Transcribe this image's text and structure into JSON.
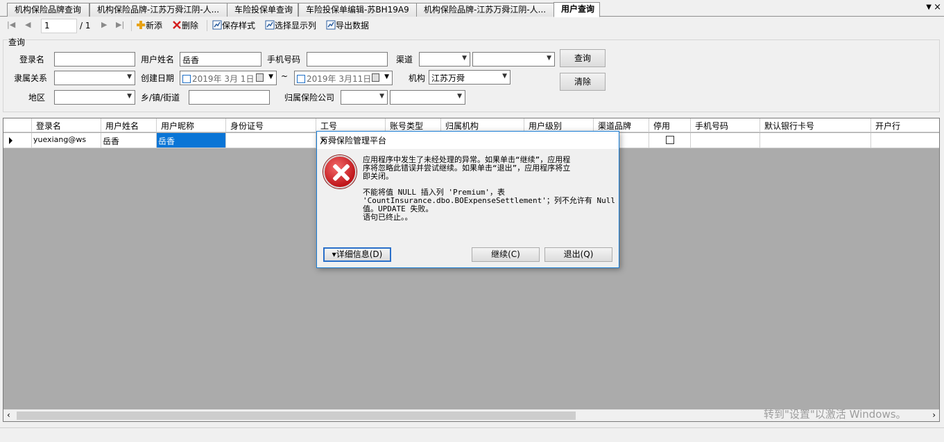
{
  "tabs": [
    {
      "label": "机构保险品牌查询"
    },
    {
      "label": "机构保险品牌-江苏万舜江阴-人..."
    },
    {
      "label": "车险投保单查询"
    },
    {
      "label": "车险投保单编辑-苏BH19A9"
    },
    {
      "label": "机构保险品牌-江苏万舜江阴-人..."
    },
    {
      "label": "用户查询"
    }
  ],
  "tab_menu_glyph": "▼",
  "tab_close_glyph": "×",
  "toolbar": {
    "page_current": "1",
    "page_total": "/ 1",
    "add_label": "新添",
    "delete_label": "删除",
    "save_style_label": "保存样式",
    "choose_columns_label": "选择显示列",
    "export_label": "导出数据"
  },
  "query": {
    "group_title": "查询",
    "login_label": "登录名",
    "login_value": "",
    "username_label": "用户姓名",
    "username_value": "岳香",
    "phone_label": "手机号码",
    "phone_value": "",
    "channel_label": "渠道",
    "affiliation_label": "隶属关系",
    "created_label": "创建日期",
    "date_from": "2019年  3月 1日",
    "date_sep": "~",
    "date_to": "2019年  3月11日",
    "org_label": "机构",
    "org_value": "江苏万舜",
    "region_label": "地区",
    "town_label": "乡/镇/街道",
    "town_value": "",
    "insurer_label": "归属保险公司",
    "search_button": "查询",
    "clear_button": "清除"
  },
  "grid": {
    "columns": [
      "登录名",
      "用户姓名",
      "用户昵称",
      "身份证号",
      "工号",
      "账号类型",
      "归属机构",
      "用户级别",
      "渠道品牌",
      "停用",
      "手机号码",
      "默认银行卡号",
      "开户行"
    ],
    "rows": [
      {
        "login": "yuexiang@ws",
        "name": "岳香",
        "nickname": "岳香",
        "disabled": false
      }
    ]
  },
  "dialog": {
    "title": "万舜保险管理平台",
    "close_glyph": "✕",
    "message_1": "应用程序中发生了未经处理的异常。如果单击“继续”，应用程\n序将忽略此错误并尝试继续。如果单击“退出”，应用程序将立\n即关闭。",
    "message_2": "不能将值 NULL 插入列 'Premium'，表\n'CountInsurance.dbo.BOExpenseSettlement'；列不允许有 Null\n值。UPDATE 失败。\n语句已终止。。",
    "details_button": "▾详细信息(D)",
    "continue_button": "继续(C)",
    "quit_button": "退出(Q)"
  },
  "watermark": "转到\"设置\"以激活 Windows。",
  "colors": {
    "selection": "#0a75d6",
    "grid_bg": "#ababab",
    "dialog_border": "#1a7ed6"
  }
}
